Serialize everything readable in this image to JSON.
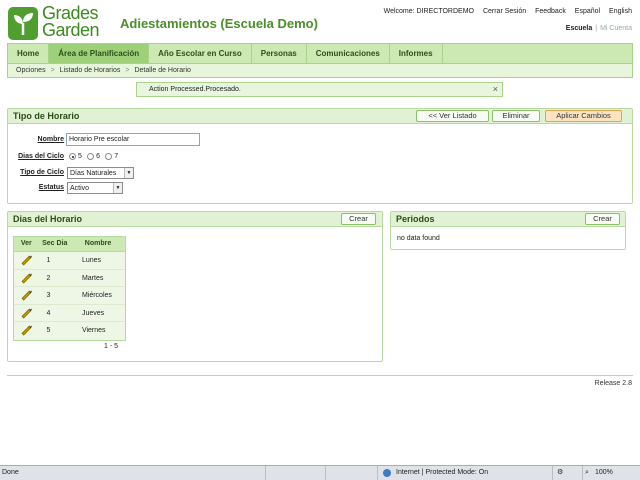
{
  "header": {
    "logo_line1": "Grades",
    "logo_line2": "Garden",
    "title": "Adiestamientos (Escuela Demo)",
    "welcome": "Welcome: DIRECTORDEMO",
    "links": [
      "Cerrar Sesión",
      "Feedback",
      "Español",
      "English"
    ],
    "school": "Escuela",
    "my_account": "Mi Cuenta"
  },
  "nav": {
    "tabs": [
      "Home",
      "Área de Planificación",
      "Año Escolar en Curso",
      "Personas",
      "Comunicaciones",
      "Informes"
    ],
    "active": "Área de Planificación"
  },
  "breadcrumb": [
    "Opciones",
    "Listado de Horarios",
    "Detalle de Horario"
  ],
  "message": "Action Processed.Procesado.",
  "message_close": "×",
  "tipo_horario": {
    "title": "Tipo de Horario",
    "buttons": {
      "back": "<< Ver Listado",
      "delete": "Eliminar",
      "apply": "Aplicar Cambios"
    },
    "fields": {
      "nombre": {
        "label": "Nombre",
        "value": "Horario Pre escolar"
      },
      "dias_ciclo": {
        "label": "Dias del Ciclo",
        "options": [
          "5",
          "6",
          "7"
        ],
        "selected": "5"
      },
      "tipo_ciclo": {
        "label": "Tipo de Ciclo",
        "value": "Días Naturales"
      },
      "estatus": {
        "label": "Estatus",
        "value": "Activo"
      }
    }
  },
  "dias_horario": {
    "title": "Dias del Horario",
    "create": "Crear",
    "columns": [
      "Ver",
      "Sec Dia",
      "Nombre"
    ],
    "rows": [
      {
        "sec": "1",
        "nombre": "Lunes"
      },
      {
        "sec": "2",
        "nombre": "Martes"
      },
      {
        "sec": "3",
        "nombre": "Miércoles"
      },
      {
        "sec": "4",
        "nombre": "Jueves"
      },
      {
        "sec": "5",
        "nombre": "Viernes"
      }
    ],
    "pagination": "1 - 5"
  },
  "periodos": {
    "title": "Periodos",
    "create": "Crear",
    "empty": "no data found"
  },
  "footer": {
    "release": "Release 2.8"
  },
  "statusbar": {
    "left": "Done",
    "zone": "Internet | Protected Mode: On",
    "zoom": "100%"
  },
  "colors": {
    "brand_green": "#4f9e2f",
    "nav_bg": "#cce8b3",
    "accent_orange": "#fce4c3"
  }
}
